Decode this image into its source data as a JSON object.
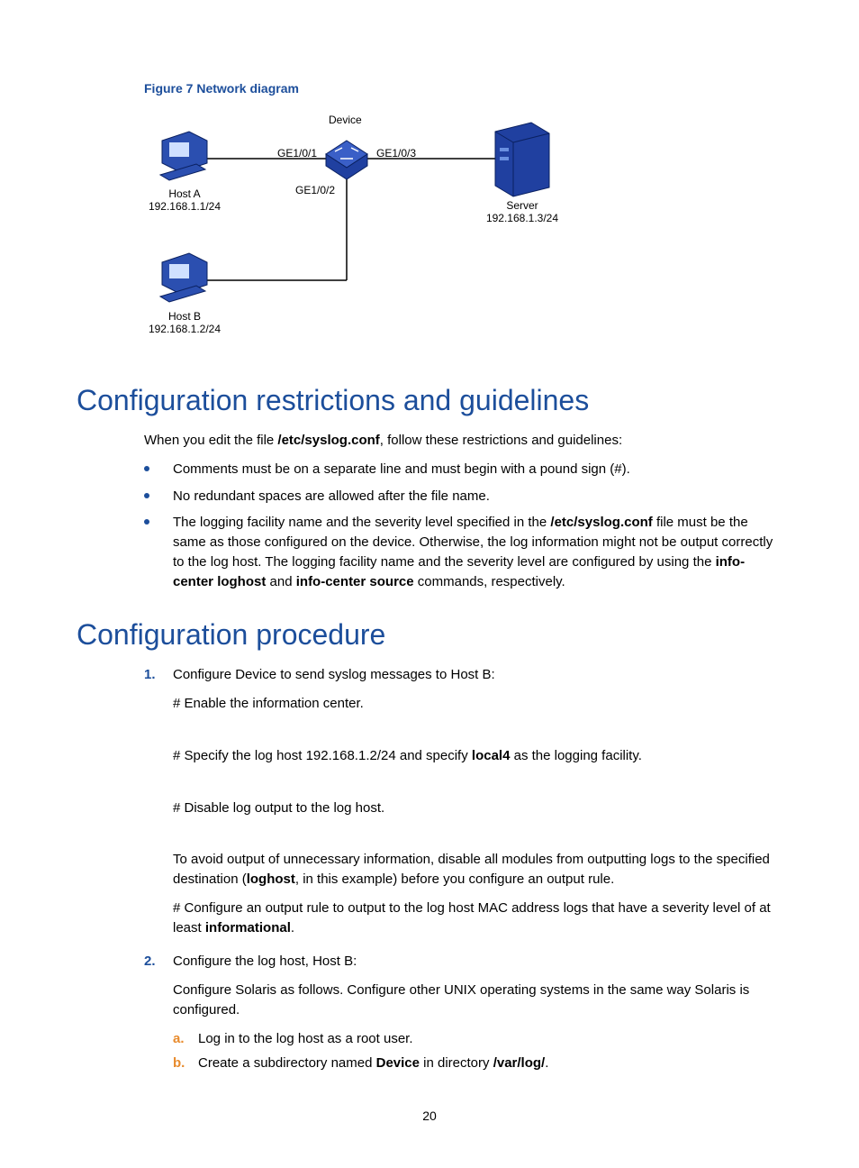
{
  "figure": {
    "caption": "Figure 7 Network diagram",
    "device_label": "Device",
    "ports": {
      "p1": "GE1/0/1",
      "p2": "GE1/0/2",
      "p3": "GE1/0/3"
    },
    "hostA": {
      "name": "Host A",
      "ip": "192.168.1.1/24"
    },
    "hostB": {
      "name": "Host B",
      "ip": "192.168.1.2/24"
    },
    "server": {
      "name": "Server",
      "ip": "192.168.1.3/24"
    }
  },
  "sections": {
    "restrictions": {
      "title": "Configuration restrictions and guidelines",
      "intro_a": "When you edit the file ",
      "intro_file": "/etc/syslog.conf",
      "intro_b": ", follow these restrictions and guidelines:",
      "bullets": {
        "b1": "Comments must be on a separate line and must begin with a pound sign (#).",
        "b2": "No redundant spaces are allowed after the file name.",
        "b3a": "The logging facility name and the severity level specified in the ",
        "b3file": "/etc/syslog.conf",
        "b3b": " file must be the same as those configured on the device. Otherwise, the log information might not be output correctly to the log host. The logging facility name and the severity level are configured by using the ",
        "b3cmd1": "info-center loghost",
        "b3mid": " and ",
        "b3cmd2": "info-center source",
        "b3end": " commands, respectively."
      }
    },
    "procedure": {
      "title": "Configuration procedure",
      "step1": {
        "head": "Configure Device to send syslog messages to Host B:",
        "p1": "# Enable the information center.",
        "p2a": "# Specify the log host 192.168.1.2/24 and specify ",
        "p2b": "local4",
        "p2c": " as the logging facility.",
        "p3": "# Disable log output to the log host.",
        "p4a": "To avoid output of unnecessary information, disable all modules from outputting logs to the specified destination (",
        "p4b": "loghost",
        "p4c": ", in this example) before you configure an output rule.",
        "p5a": "# Configure an output rule to output to the log host MAC address logs that have a severity level of at least ",
        "p5b": "informational",
        "p5c": "."
      },
      "step2": {
        "head": "Configure the log host, Host B:",
        "p1": "Configure Solaris as follows. Configure other UNIX operating systems in the same way Solaris is configured.",
        "sa": "Log in to the log host as a root user.",
        "sb_a": "Create a subdirectory named ",
        "sb_b": "Device",
        "sb_c": " in directory ",
        "sb_d": "/var/log/",
        "sb_e": "."
      }
    }
  },
  "page_number": "20"
}
